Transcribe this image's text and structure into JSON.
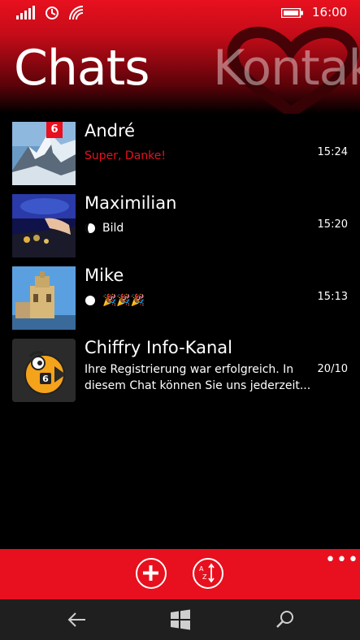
{
  "status_bar": {
    "time": "16:00",
    "signal_label": "1"
  },
  "pivot": {
    "title": "Chats",
    "next_title": "Kontakte"
  },
  "chats": [
    {
      "name": "André",
      "message": "Super, Danke!",
      "time": "15:24",
      "unread": "6",
      "avatar": "mountain-photo"
    },
    {
      "name": "Maximilian",
      "message": "Bild",
      "time": "15:20",
      "avatar": "dj-photo"
    },
    {
      "name": "Mike",
      "message": "🎉🎉🎉",
      "time": "15:13",
      "avatar": "tower-photo"
    },
    {
      "name": "Chiffry Info-Kanal",
      "message": "Ihre Registrierung war erfolgreich. In diesem Chat können Sie uns jederzeit...",
      "time": "20/10",
      "avatar": "chiffry-logo"
    }
  ],
  "app_bar": {
    "more_label": "•••",
    "add_icon": "add-icon",
    "sort_icon": "sort-icon"
  },
  "colors": {
    "accent": "#e8101e",
    "background": "#000000",
    "navbar": "#1f1f1f"
  }
}
